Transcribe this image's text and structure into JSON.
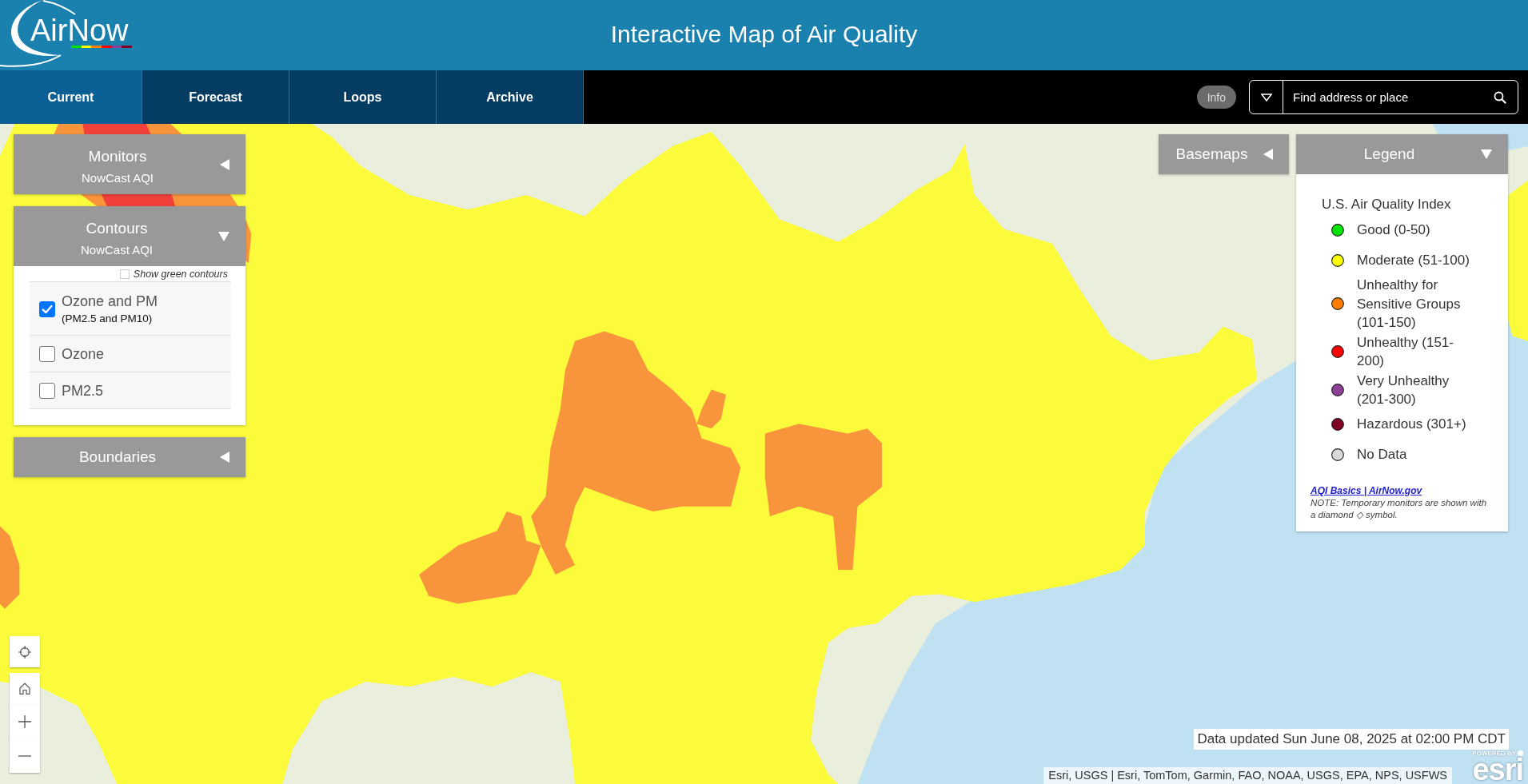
{
  "header": {
    "logo": "AirNow",
    "title": "Interactive Map of Air Quality"
  },
  "nav": {
    "tabs": [
      {
        "label": "Current",
        "selected": true
      },
      {
        "label": "Forecast",
        "selected": false
      },
      {
        "label": "Loops",
        "selected": false
      },
      {
        "label": "Archive",
        "selected": false
      }
    ],
    "info_button": "Info",
    "search": {
      "placeholder": "Find address or place"
    }
  },
  "left_panels": [
    {
      "kind": "selector",
      "title": "Monitors",
      "subtitle": "NowCast AQI",
      "expanded": false
    },
    {
      "kind": "layers",
      "title": "Contours",
      "subtitle": "NowCast AQI",
      "expanded": true,
      "green_contours": {
        "label": "Show green contours",
        "checked": false
      },
      "options": [
        {
          "label": "Ozone and PM",
          "note": "(PM2.5 and PM10)",
          "checked": true
        },
        {
          "label": "Ozone",
          "checked": false
        },
        {
          "label": "PM2.5",
          "checked": false
        }
      ]
    },
    {
      "kind": "selector",
      "title": "Boundaries",
      "expanded": false
    }
  ],
  "right_panels": [
    {
      "kind": "selector",
      "title": "Basemaps",
      "expanded": false
    },
    {
      "kind": "legend",
      "title": "Legend",
      "expanded": true,
      "heading": "U.S. Air Quality Index",
      "items": [
        {
          "label": "Good (0-50)",
          "color": "#00e400"
        },
        {
          "label": "Moderate (51-100)",
          "color": "#ffff00"
        },
        {
          "label": "Unhealthy for Sensitive Groups (101-150)",
          "color": "#ff7e00"
        },
        {
          "label": "Unhealthy (151-200)",
          "color": "#ff0000"
        },
        {
          "label": "Very Unhealthy (201-300)",
          "color": "#8f3f97"
        },
        {
          "label": "Hazardous (301+)",
          "color": "#7e0023"
        },
        {
          "label": "No Data",
          "color": "#d9d9d9"
        }
      ],
      "link": "AQI Basics | AirNow.gov",
      "note": "NOTE: Temporary monitors are shown with a diamond ◇ symbol."
    }
  ],
  "status": {
    "updated": "Data updated Sun June 08, 2025 at 02:00 PM CDT",
    "attribution": "Esri, USGS | Esri, TomTom, Garmin, FAO, NOAA, USGS, EPA, NPS, USFWS",
    "esri": {
      "tagline": "POWERED BY",
      "wordmark": "esri"
    }
  }
}
